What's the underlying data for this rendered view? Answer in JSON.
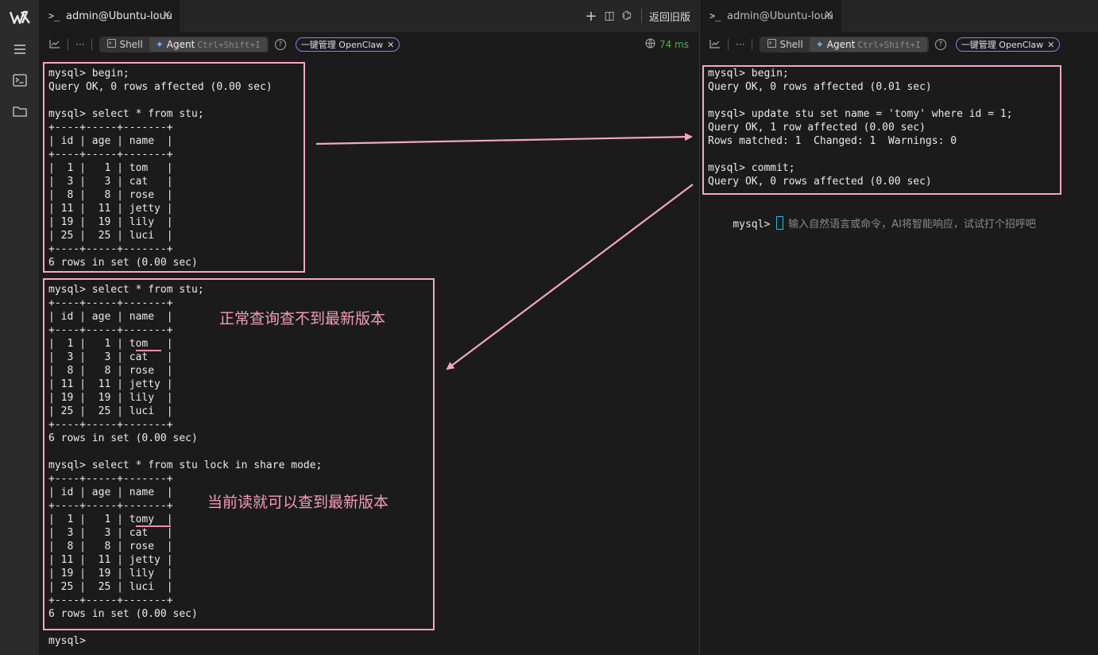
{
  "sidebar": {
    "items": [
      "logo-icon",
      "menu-icon",
      "terminal-icon",
      "folder-icon"
    ]
  },
  "left_pane": {
    "tab": {
      "title": "admin@Ubuntu-louu",
      "prompt_symbol": ">_",
      "close": "✕"
    },
    "actions": {
      "add": "+",
      "split": "◫",
      "agent": "⌬",
      "back_label": "返回旧版"
    },
    "toolbar": {
      "more": "···",
      "shell_label": "Shell",
      "agent_label": "Agent",
      "agent_shortcut": "Ctrl+Shift+I",
      "help": "?",
      "openclaw_label": "一键管理 OpenClaw",
      "openclaw_close": "✕",
      "latency": "74 ms"
    },
    "session1": {
      "lines": [
        "mysql> begin;",
        "Query OK, 0 rows affected (0.00 sec)",
        "",
        "mysql> select * from stu;",
        "+----+-----+-------+",
        "| id | age | name  |",
        "+----+-----+-------+",
        "|  1 |   1 | tom   |",
        "|  3 |   3 | cat   |",
        "|  8 |   8 | rose  |",
        "| 11 |  11 | jetty |",
        "| 19 |  19 | lily  |",
        "| 25 |  25 | luci  |",
        "+----+-----+-------+",
        "6 rows in set (0.00 sec)"
      ]
    },
    "session2": {
      "lines": [
        "mysql> select * from stu;",
        "+----+-----+-------+",
        "| id | age | name  |",
        "+----+-----+-------+",
        "|  1 |   1 | tom   |",
        "|  3 |   3 | cat   |",
        "|  8 |   8 | rose  |",
        "| 11 |  11 | jetty |",
        "| 19 |  19 | lily  |",
        "| 25 |  25 | luci  |",
        "+----+-----+-------+",
        "6 rows in set (0.00 sec)",
        "",
        "mysql> select * from stu lock in share mode;",
        "+----+-----+-------+",
        "| id | age | name  |",
        "+----+-----+-------+",
        "|  1 |   1 | tomy  |",
        "|  3 |   3 | cat   |",
        "|  8 |   8 | rose  |",
        "| 11 |  11 | jetty |",
        "| 19 |  19 | lily  |",
        "| 25 |  25 | luci  |",
        "+----+-----+-------+",
        "6 rows in set (0.00 sec)"
      ]
    },
    "prompt": "mysql>",
    "annotations": {
      "snapshot_read": "正常查询查不到最新版本",
      "current_read": "当前读就可以查到最新版本"
    }
  },
  "right_pane": {
    "tab": {
      "title": "admin@Ubuntu-louu",
      "prompt_symbol": ">_",
      "close": "✕"
    },
    "toolbar": {
      "more": "···",
      "shell_label": "Shell",
      "agent_label": "Agent",
      "agent_shortcut": "Ctrl+Shift+I",
      "help": "?",
      "openclaw_label": "一键管理 OpenClaw",
      "openclaw_close": "✕"
    },
    "session": {
      "lines": [
        "mysql> begin;",
        "Query OK, 0 rows affected (0.01 sec)",
        "",
        "mysql> update stu set name = 'tomy' where id = 1;",
        "Query OK, 1 row affected (0.00 sec)",
        "Rows matched: 1  Changed: 1  Warnings: 0",
        "",
        "mysql> commit;",
        "Query OK, 0 rows affected (0.00 sec)"
      ]
    },
    "prompt": "mysql>",
    "input_placeholder": "输入自然语言或命令，AI将智能响应，试试打个招呼吧"
  },
  "colors": {
    "annotation": "#f4a7c4",
    "latency": "#4caf50",
    "cursor": "#29b6f6",
    "openclaw_border": "#8f7dea"
  }
}
